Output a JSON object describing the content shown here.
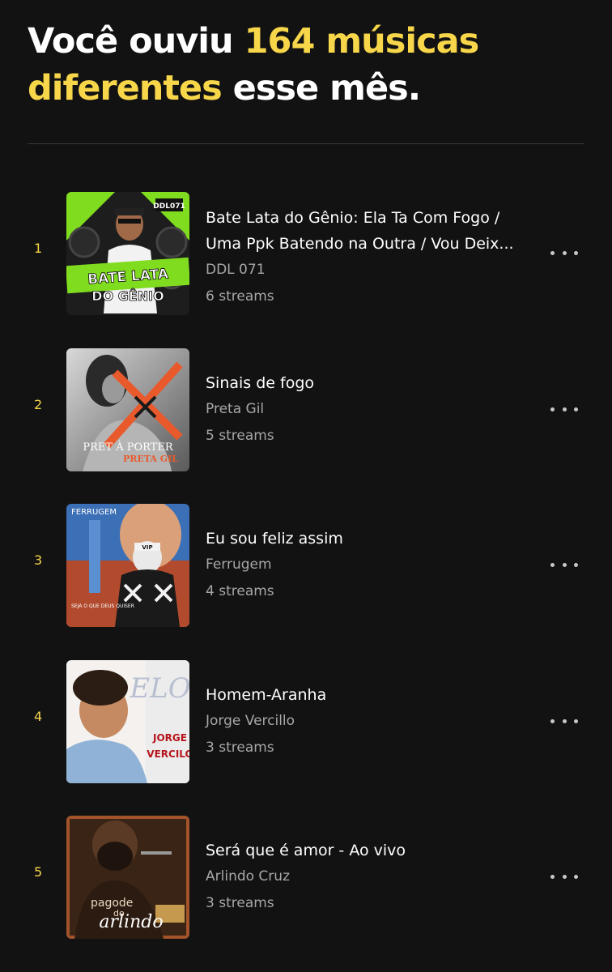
{
  "header": {
    "prefix": "Você ouviu ",
    "highlight": "164 músicas diferentes",
    "suffix": " esse mês."
  },
  "tracks": [
    {
      "rank": "1",
      "title": "Bate Lata do Gênio: Ela Ta Com Fogo / Uma Ppk Batendo na Outra / Vou Deix...",
      "artist": "DDL 071",
      "streams": "6 streams",
      "cover_text": [
        "BATE LATA",
        "DO GÊNIO",
        "DDL071"
      ]
    },
    {
      "rank": "2",
      "title": "Sinais de fogo",
      "artist": "Preta Gil",
      "streams": "5 streams",
      "cover_text": [
        "PRET À PORTER",
        "PRETA GIL"
      ]
    },
    {
      "rank": "3",
      "title": "Eu sou feliz assim",
      "artist": "Ferrugem",
      "streams": "4 streams",
      "cover_text": [
        "FERRUGEM",
        "SEJA O QUE DEUS QUISER",
        "VIP"
      ]
    },
    {
      "rank": "4",
      "title": "Homem-Aranha",
      "artist": "Jorge Vercillo",
      "streams": "3 streams",
      "cover_text": [
        "ELO",
        "JORGE",
        "VERCILO"
      ]
    },
    {
      "rank": "5",
      "title": "Será que é amor - Ao vivo",
      "artist": "Arlindo Cruz",
      "streams": "3 streams",
      "cover_text": [
        "pagode",
        "do",
        "arlindo"
      ]
    }
  ],
  "colors": {
    "accent": "#f7d64a",
    "background": "#121212",
    "secondary_text": "#a7a7a7"
  },
  "icons": {
    "more": "more-options-icon"
  }
}
